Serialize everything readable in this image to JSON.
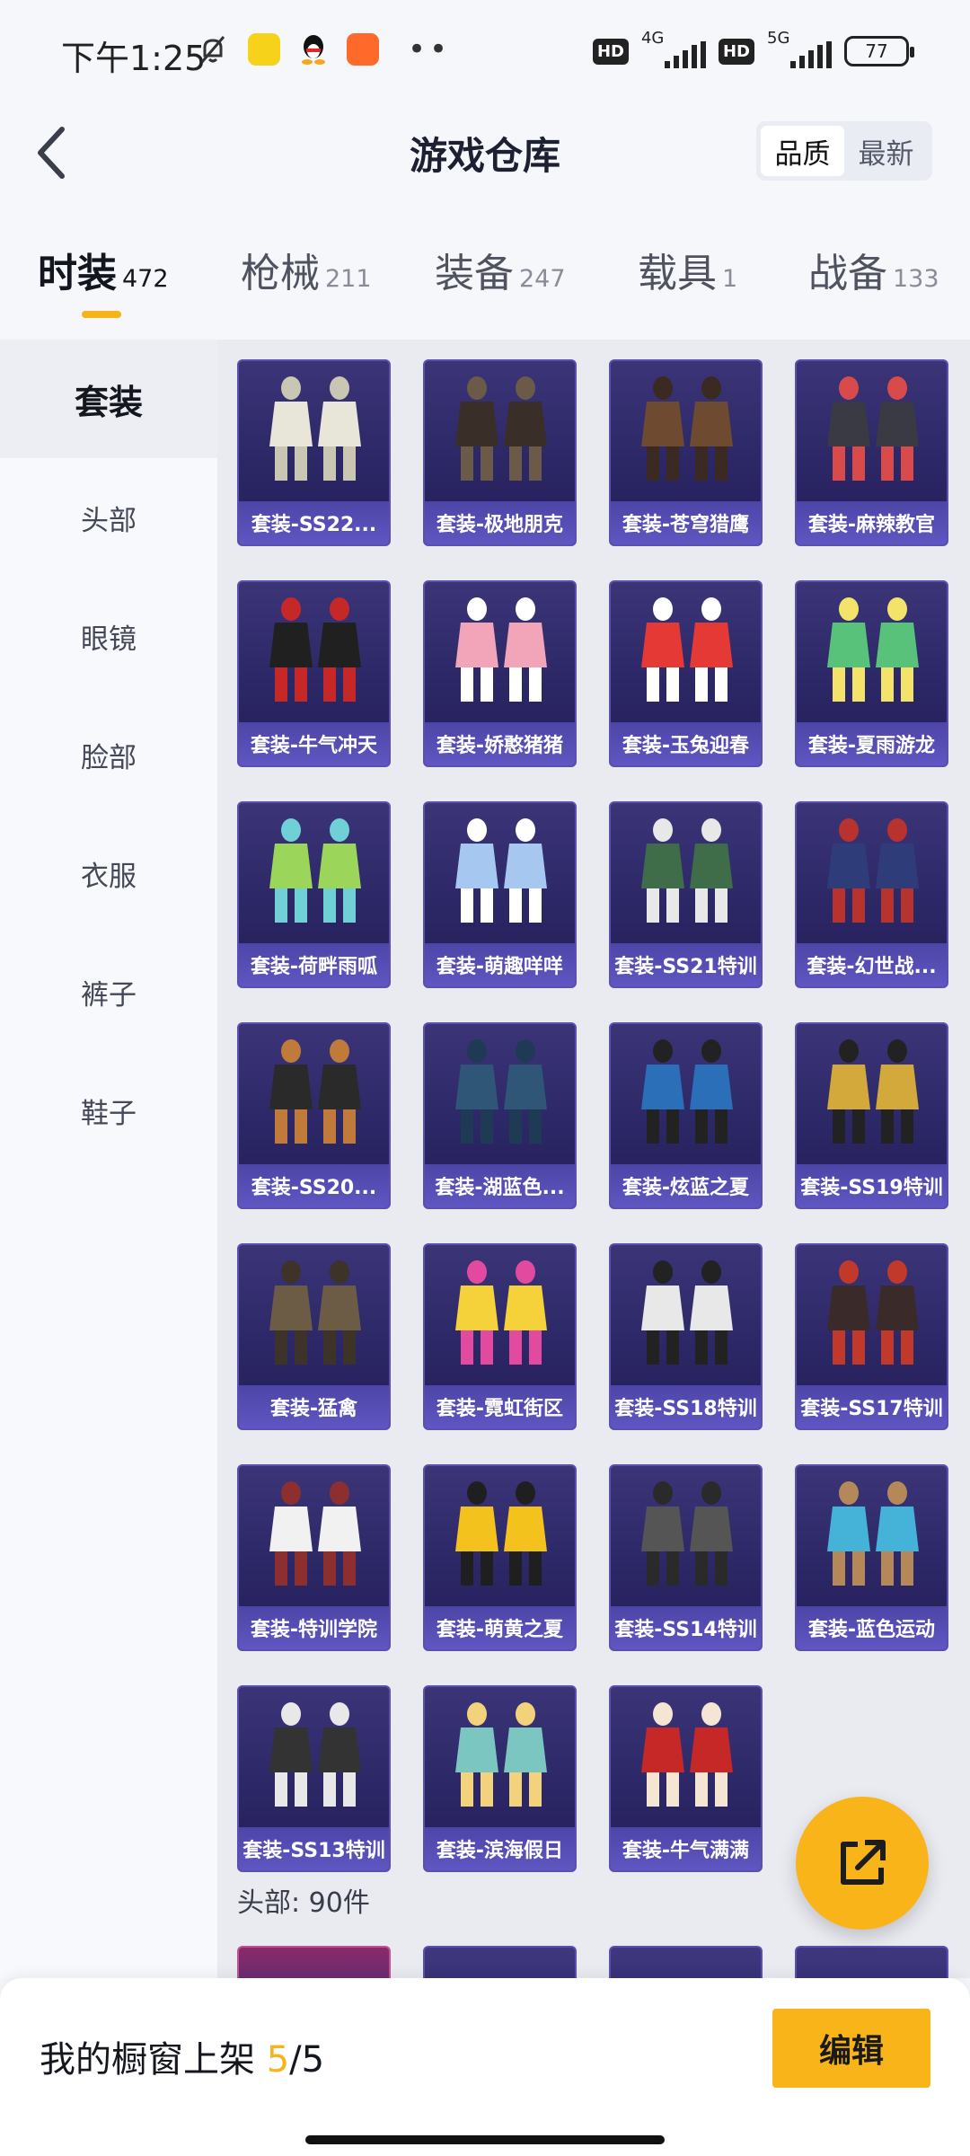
{
  "status_bar": {
    "time": "下午1:25",
    "network_1": "4G",
    "network_2": "5G",
    "hd_1": "HD",
    "hd_2": "HD",
    "battery": "77",
    "icons": [
      "mute-bell-icon",
      "app-yellow-icon",
      "qq-penguin-icon",
      "app-orange-icon",
      "more-dots-icon"
    ]
  },
  "header": {
    "title": "游戏仓库",
    "sort_options": [
      "品质",
      "最新"
    ],
    "active_sort": "品质"
  },
  "tabs": [
    {
      "name": "时装",
      "count": "472",
      "active": true
    },
    {
      "name": "枪械",
      "count": "211",
      "active": false
    },
    {
      "name": "装备",
      "count": "247",
      "active": false
    },
    {
      "name": "载具",
      "count": "1",
      "active": false
    },
    {
      "name": "战备",
      "count": "133",
      "active": false
    }
  ],
  "sidebar": {
    "items": [
      "套装",
      "头部",
      "眼镜",
      "脸部",
      "衣服",
      "裤子",
      "鞋子"
    ],
    "active": "套装"
  },
  "items": [
    "套装-SS22...",
    "套装-极地朋克",
    "套装-苍穹猎鹰",
    "套装-麻辣教官",
    "套装-牛气冲天",
    "套装-娇憨猪猪",
    "套装-玉兔迎春",
    "套装-夏雨游龙",
    "套装-荷畔雨呱",
    "套装-萌趣咩咩",
    "套装-SS21特训",
    "套装-幻世战...",
    "套装-SS20...",
    "套装-湖蓝色...",
    "套装-炫蓝之夏",
    "套装-SS19特训",
    "套装-猛禽",
    "套装-霓虹街区",
    "套装-SS18特训",
    "套装-SS17特训",
    "套装-特训学院",
    "套装-萌黄之夏",
    "套装-SS14特训",
    "套装-蓝色运动",
    "套装-SS13特训",
    "套装-滨海假日",
    "套装-牛气满满"
  ],
  "head_section_label": "头部: 90件",
  "bottom_bar": {
    "showcase_label": "我的橱窗上架",
    "showcase_current": "5",
    "showcase_total": "/5",
    "edit_label": "编辑"
  },
  "colors": {
    "accent": "#f8b418",
    "card_bg": "#2c2766",
    "card_label_bg": "#5a51bb"
  }
}
